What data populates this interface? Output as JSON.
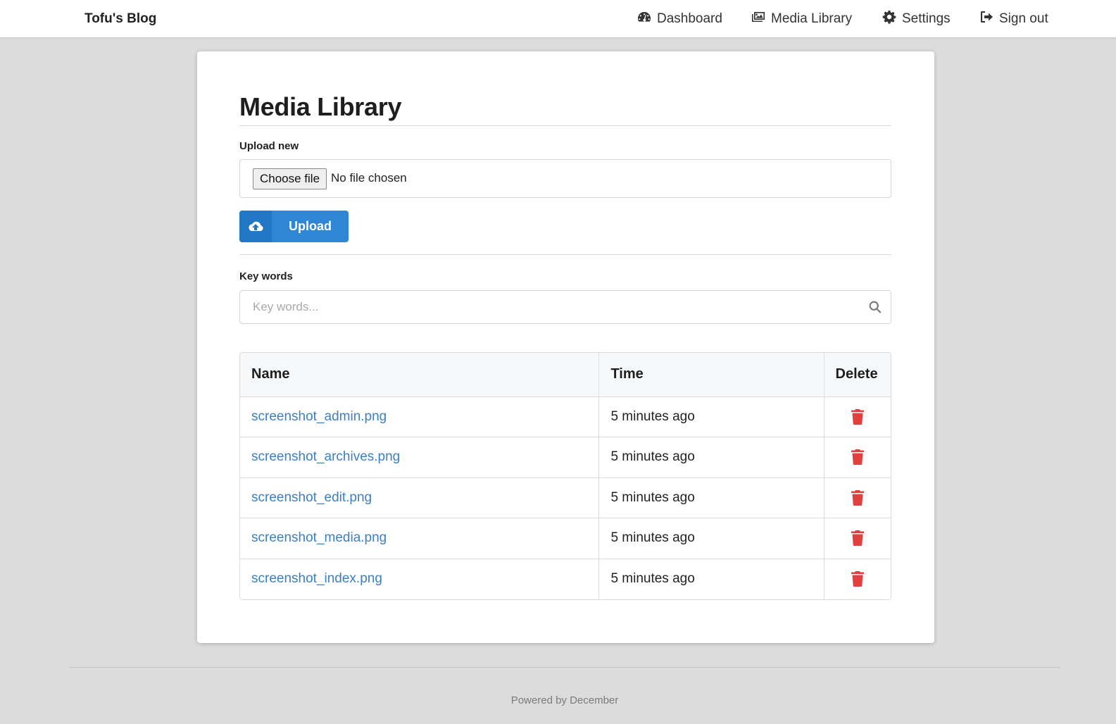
{
  "header": {
    "brand": "Tofu's Blog",
    "nav": [
      {
        "label": "Dashboard",
        "icon": "dashboard-icon"
      },
      {
        "label": "Media Library",
        "icon": "media-library-icon"
      },
      {
        "label": "Settings",
        "icon": "gear-icon"
      },
      {
        "label": "Sign out",
        "icon": "sign-out-icon"
      }
    ]
  },
  "page": {
    "title": "Media Library",
    "upload_label": "Upload new",
    "choose_file_label": "Choose file",
    "no_file_text": "No file chosen",
    "upload_button": "Upload",
    "keywords_label": "Key words",
    "keywords_placeholder": "Key words...",
    "keywords_value": ""
  },
  "table": {
    "headers": {
      "name": "Name",
      "time": "Time",
      "delete": "Delete"
    },
    "rows": [
      {
        "name": "screenshot_admin.png",
        "time": "5 minutes ago"
      },
      {
        "name": "screenshot_archives.png",
        "time": "5 minutes ago"
      },
      {
        "name": "screenshot_edit.png",
        "time": "5 minutes ago"
      },
      {
        "name": "screenshot_media.png",
        "time": "5 minutes ago"
      },
      {
        "name": "screenshot_index.png",
        "time": "5 minutes ago"
      }
    ]
  },
  "footer": {
    "text": "Powered by December"
  },
  "colors": {
    "primary": "#2e86d4",
    "link": "#3b7fc4",
    "danger": "#e0413f",
    "background": "#dcdcdc"
  }
}
